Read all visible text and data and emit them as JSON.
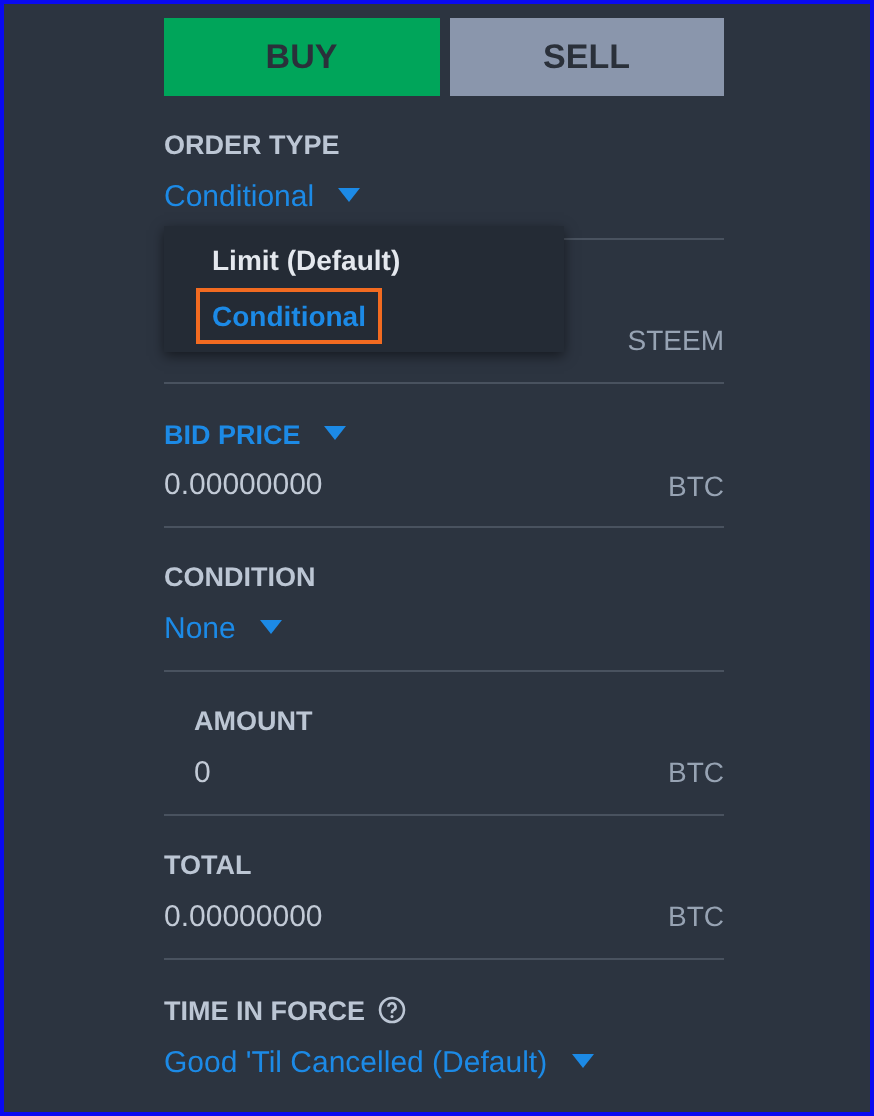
{
  "side_buttons": [
    {
      "label": "BUY",
      "kind": "buy",
      "selected": true
    },
    {
      "label": "SELL",
      "kind": "sell",
      "selected": false
    }
  ],
  "fields": [
    {
      "kind": "select",
      "label": "ORDER TYPE",
      "value": "Conditional",
      "menu": [
        {
          "label": "Limit (Default)",
          "selected": false
        },
        {
          "label": "Conditional",
          "selected": true
        }
      ]
    },
    {
      "kind": "covered",
      "unit": "STEEM"
    },
    {
      "kind": "input",
      "label": "BID PRICE",
      "label_dropdown": true,
      "value": "0.00000000",
      "unit": "BTC"
    },
    {
      "kind": "select",
      "label": "CONDITION",
      "value": "None"
    },
    {
      "kind": "input",
      "label": "AMOUNT",
      "indented": true,
      "value": "0",
      "unit": "BTC"
    },
    {
      "kind": "input",
      "label": "TOTAL",
      "value": "0.00000000",
      "unit": "BTC"
    },
    {
      "kind": "select",
      "label": "TIME IN FORCE",
      "help": true,
      "value": "Good 'Til Cancelled (Default)"
    }
  ]
}
